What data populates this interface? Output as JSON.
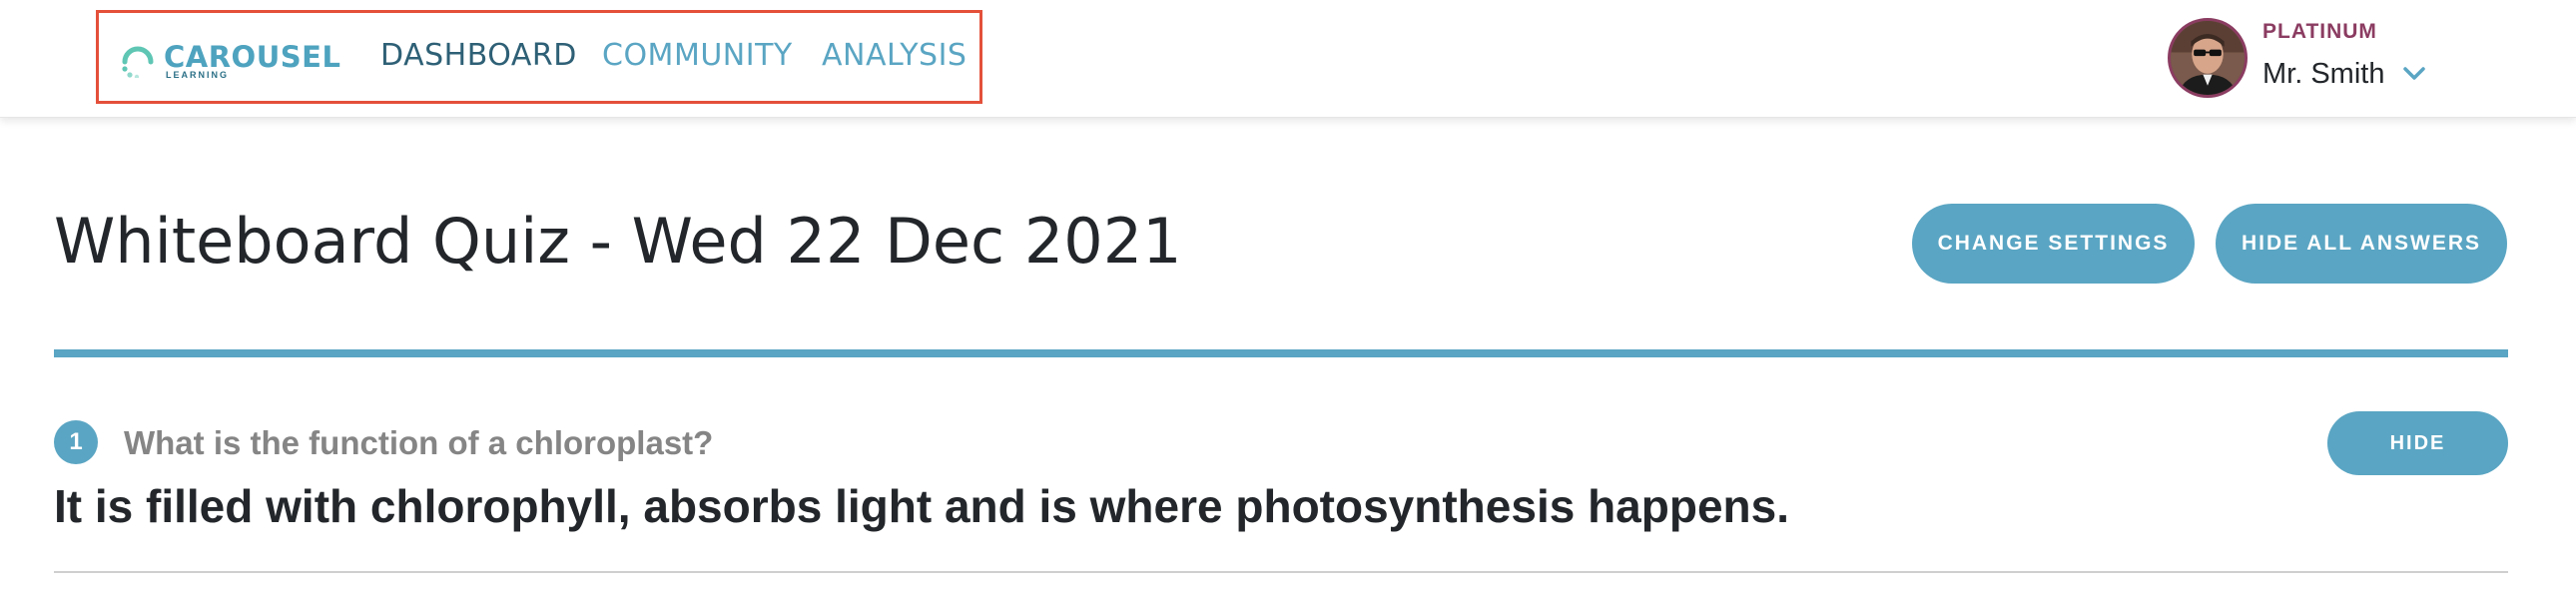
{
  "header": {
    "logo": {
      "name": "CAROUSEL",
      "sub": "LEARNING"
    },
    "nav": [
      {
        "label": "DASHBOARD"
      },
      {
        "label": "COMMUNITY"
      },
      {
        "label": "ANALYSIS"
      }
    ],
    "user": {
      "tier": "PLATINUM",
      "name": "Mr. Smith"
    }
  },
  "page": {
    "title": "Whiteboard Quiz - Wed 22 Dec 2021",
    "buttons": {
      "change_settings": "CHANGE SETTINGS",
      "hide_all_answers": "HIDE ALL ANSWERS"
    }
  },
  "questions": [
    {
      "number": "1",
      "question": "What is the function of a chloroplast?",
      "answer": "It is filled with chlorophyll, absorbs light and is where photosynthesis happens.",
      "hide_label": "HIDE"
    }
  ],
  "icons": {
    "user_menu": "chevron-down-icon",
    "logo": "carousel-logo-icon"
  },
  "colors": {
    "accent": "#5aa5c3",
    "nav_active": "#2e6076",
    "tier": "#8b3c61",
    "highlight": "#e4503a"
  }
}
